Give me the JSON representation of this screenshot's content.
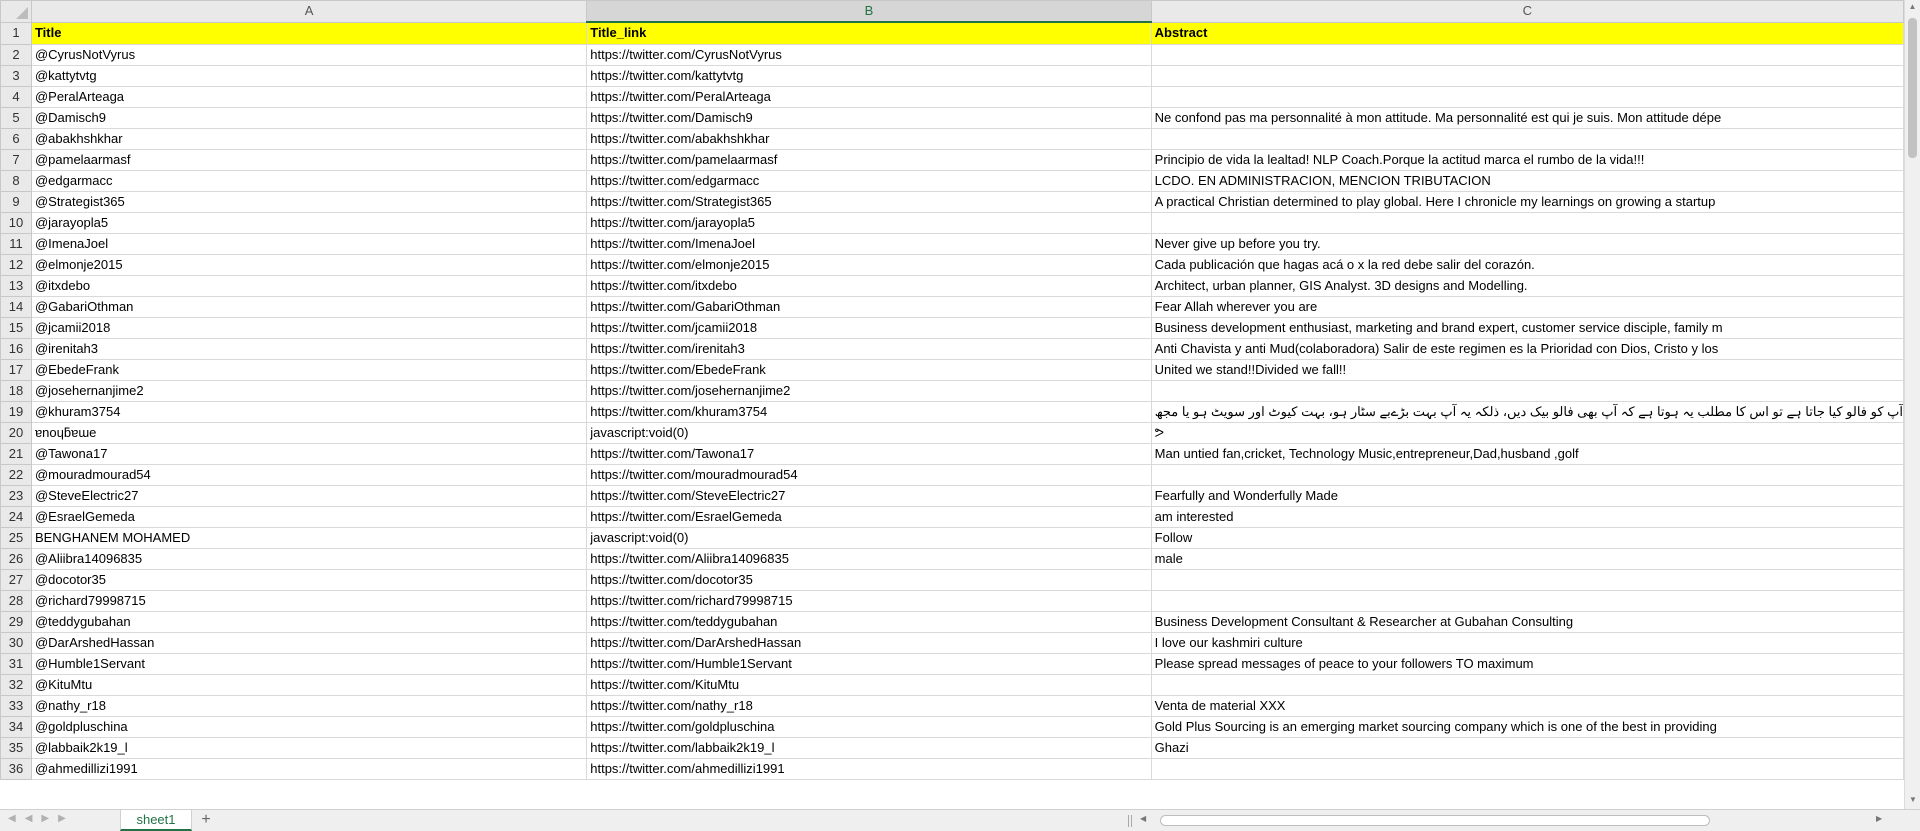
{
  "columns": [
    "A",
    "B",
    "C"
  ],
  "selected_column": "B",
  "header": {
    "row": "1",
    "title": "Title",
    "link": "Title_link",
    "abstract": "Abstract"
  },
  "rows": [
    {
      "n": "2",
      "title": "@CyrusNotVyrus",
      "link": "https://twitter.com/CyrusNotVyrus",
      "abstract": ""
    },
    {
      "n": "3",
      "title": "@kattytvtg",
      "link": "https://twitter.com/kattytvtg",
      "abstract": ""
    },
    {
      "n": "4",
      "title": "@PeralArteaga",
      "link": "https://twitter.com/PeralArteaga",
      "abstract": ""
    },
    {
      "n": "5",
      "title": "@Damisch9",
      "link": "https://twitter.com/Damisch9",
      "abstract": "Ne confond pas ma personnalité à mon attitude. Ma personnalité est qui je suis. Mon attitude dépe"
    },
    {
      "n": "6",
      "title": "@abakhshkhar",
      "link": "https://twitter.com/abakhshkhar",
      "abstract": ""
    },
    {
      "n": "7",
      "title": "@pamelaarmasf",
      "link": "https://twitter.com/pamelaarmasf",
      "abstract": "Principio de vida la lealtad! NLP Coach.Porque la actitud marca el rumbo de la vida!!!"
    },
    {
      "n": "8",
      "title": "@edgarmacc",
      "link": "https://twitter.com/edgarmacc",
      "abstract": "LCDO. EN ADMINISTRACION, MENCION TRIBUTACION"
    },
    {
      "n": "9",
      "title": "@Strategist365",
      "link": "https://twitter.com/Strategist365",
      "abstract": "A practical Christian determined to play global. Here I chronicle my learnings on growing a startup"
    },
    {
      "n": "10",
      "title": "@jarayopla5",
      "link": "https://twitter.com/jarayopla5",
      "abstract": ""
    },
    {
      "n": "11",
      "title": "@ImenaJoel",
      "link": "https://twitter.com/ImenaJoel",
      "abstract": "Never give up before you try."
    },
    {
      "n": "12",
      "title": "@elmonje2015",
      "link": "https://twitter.com/elmonje2015",
      "abstract": "Cada publicación que hagas acá o x la red debe salir del corazón."
    },
    {
      "n": "13",
      "title": "@itxdebo",
      "link": "https://twitter.com/itxdebo",
      "abstract": "Architect, urban planner, GIS Analyst. 3D designs and Modelling."
    },
    {
      "n": "14",
      "title": "@GabariOthman",
      "link": "https://twitter.com/GabariOthman",
      "abstract": "Fear Allah wherever you are"
    },
    {
      "n": "15",
      "title": "@jcamii2018",
      "link": "https://twitter.com/jcamii2018",
      "abstract": "Business development enthusiast, marketing and brand expert,  customer service disciple, family m"
    },
    {
      "n": "16",
      "title": "@irenitah3",
      "link": "https://twitter.com/irenitah3",
      "abstract": "Anti Chavista y anti Mud(colaboradora) Salir de este regimen es la Prioridad con Dios, Cristo y los"
    },
    {
      "n": "17",
      "title": "@EbedeFrank",
      "link": "https://twitter.com/EbedeFrank",
      "abstract": "United we stand!!Divided we fall!!"
    },
    {
      "n": "18",
      "title": "@josehernanjime2",
      "link": "https://twitter.com/josehernanjime2",
      "abstract": ""
    },
    {
      "n": "19",
      "title": "@khuram3754",
      "link": "https://twitter.com/khuram3754",
      "abstract": "آپ کو فالو کیا جاتا ہے تو اس کا مطلب یہ ہوتا ہے کہ آپ بھی فالو بیک دیں، ذلکہ یہ آپ بہت بڑےبے سٹار ہو، بہت کیوٹ اور سویٹ ہو یا مجھ"
    },
    {
      "n": "20",
      "title": "ɐnoɥƃɐɯe",
      "link": "javascript:void(0)",
      "abstract": "ᕗ"
    },
    {
      "n": "21",
      "title": "@Tawona17",
      "link": "https://twitter.com/Tawona17",
      "abstract": "Man untied fan,cricket, Technology Music,entrepreneur,Dad,husband ,golf"
    },
    {
      "n": "22",
      "title": "@mouradmourad54",
      "link": "https://twitter.com/mouradmourad54",
      "abstract": ""
    },
    {
      "n": "23",
      "title": "@SteveElectric27",
      "link": "https://twitter.com/SteveElectric27",
      "abstract": "Fearfully and Wonderfully Made"
    },
    {
      "n": "24",
      "title": "@EsraelGemeda",
      "link": "https://twitter.com/EsraelGemeda",
      "abstract": "am interested"
    },
    {
      "n": "25",
      "title": "BENGHANEM MOHAMED",
      "link": "javascript:void(0)",
      "abstract": "Follow"
    },
    {
      "n": "26",
      "title": "@Aliibra14096835",
      "link": "https://twitter.com/Aliibra14096835",
      "abstract": "male"
    },
    {
      "n": "27",
      "title": "@docotor35",
      "link": "https://twitter.com/docotor35",
      "abstract": ""
    },
    {
      "n": "28",
      "title": "@richard79998715",
      "link": "https://twitter.com/richard79998715",
      "abstract": ""
    },
    {
      "n": "29",
      "title": "@teddygubahan",
      "link": "https://twitter.com/teddygubahan",
      "abstract": "Business Development Consultant & Researcher at Gubahan Consulting"
    },
    {
      "n": "30",
      "title": "@DarArshedHassan",
      "link": "https://twitter.com/DarArshedHassan",
      "abstract": "I love our kashmiri culture"
    },
    {
      "n": "31",
      "title": "@Humble1Servant",
      "link": "https://twitter.com/Humble1Servant",
      "abstract": "Please spread messages of peace to your followers TO maximum"
    },
    {
      "n": "32",
      "title": "@KituMtu",
      "link": "https://twitter.com/KituMtu",
      "abstract": ""
    },
    {
      "n": "33",
      "title": "@nathy_r18",
      "link": "https://twitter.com/nathy_r18",
      "abstract": "Venta de material XXX"
    },
    {
      "n": "34",
      "title": "@goldpluschina",
      "link": "https://twitter.com/goldpluschina",
      "abstract": "Gold Plus Sourcing is an emerging market sourcing company which is one of the best in providing"
    },
    {
      "n": "35",
      "title": "@labbaik2k19_l",
      "link": "https://twitter.com/labbaik2k19_l",
      "abstract": "Ghazi"
    },
    {
      "n": "36",
      "title": "@ahmedillizi1991",
      "link": "https://twitter.com/ahmedillizi1991",
      "abstract": ""
    }
  ],
  "sheet_tabs": [
    {
      "label": "sheet1",
      "active": true
    }
  ],
  "add_sheet_label": "+",
  "colors": {
    "header_fill": "#ffff00",
    "accent": "#217346",
    "grid": "#d9d9d9",
    "header_bg": "#e9e9e9"
  }
}
